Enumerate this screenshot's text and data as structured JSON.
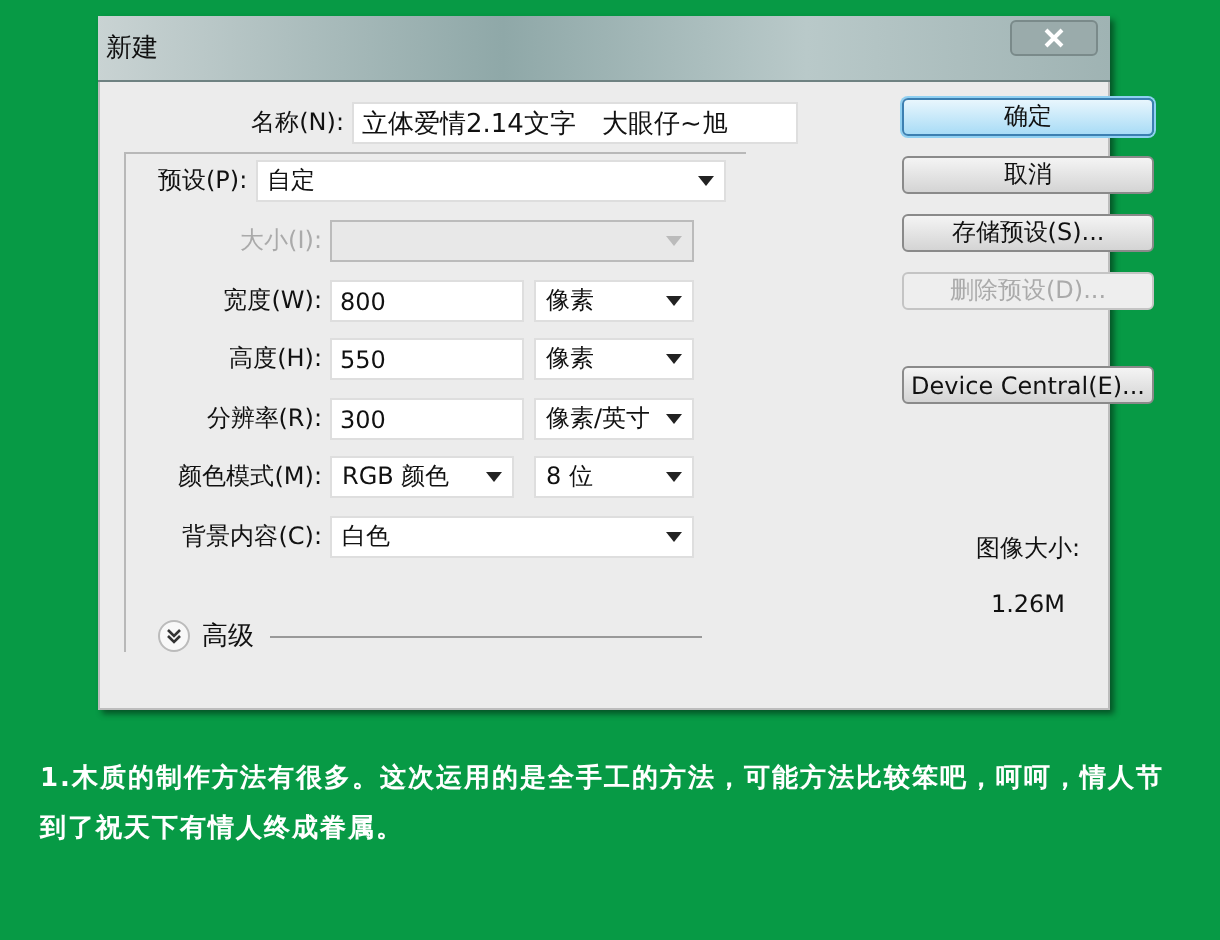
{
  "window": {
    "title": "新建"
  },
  "name_field": {
    "label": "名称(N):",
    "value": "立体爱情2.14文字　大眼仔~旭"
  },
  "preset": {
    "label": "预设(P):",
    "value": "自定"
  },
  "rows": [
    {
      "kind": "select",
      "label": "大小(I):",
      "disabled": true
    },
    {
      "kind": "input_unit",
      "label": "宽度(W):",
      "value": "800",
      "unit": "像素",
      "disabled": false
    },
    {
      "kind": "input_unit",
      "label": "高度(H):",
      "value": "550",
      "unit": "像素",
      "disabled": false
    },
    {
      "kind": "input_unit",
      "label": "分辨率(R):",
      "value": "300",
      "unit": "像素/英寸",
      "disabled": false
    },
    {
      "kind": "two_selects",
      "label": "颜色模式(M):",
      "value": "RGB 颜色",
      "unit": "8 位",
      "disabled": false
    },
    {
      "kind": "select",
      "label": "背景内容(C):",
      "value": "白色",
      "disabled": false
    }
  ],
  "advanced": {
    "label": "高级",
    "expanded": false
  },
  "buttons": [
    {
      "label": "确定",
      "default": true,
      "disabled": false
    },
    {
      "label": "取消",
      "default": false,
      "disabled": false
    },
    {
      "label": "存储预设(S)...",
      "default": false,
      "disabled": false
    },
    {
      "label": "删除预设(D)...",
      "default": false,
      "disabled": true
    },
    {
      "label": "Device Central(E)...",
      "default": false,
      "disabled": false
    }
  ],
  "image_size": {
    "label": "图像大小:",
    "value": "1.26M"
  },
  "caption": "1.木质的制作方法有很多。这次运用的是全手工的方法，可能方法比较笨吧，呵呵，情人节到了祝天下有情人终成眷属。"
}
